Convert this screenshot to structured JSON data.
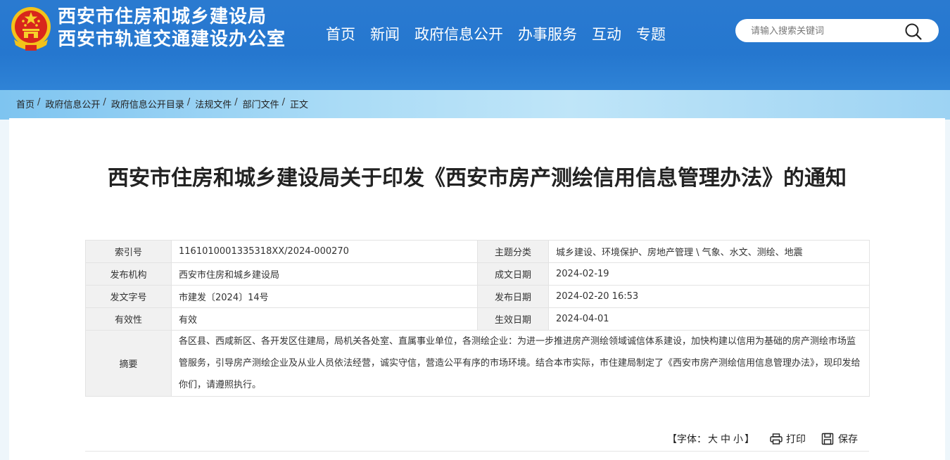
{
  "header": {
    "org_name_1": "西安市住房和城乡建设局",
    "org_name_2": "西安市轨道交通建设办公室",
    "emblem_icon": "national-emblem-icon",
    "bg_color": "#2577cf"
  },
  "nav": {
    "items": [
      "首页",
      "新闻",
      "政府信息公开",
      "办事服务",
      "互动",
      "专题"
    ]
  },
  "search": {
    "placeholder": "请输入搜索关键词",
    "icon": "search-icon"
  },
  "breadcrumb": {
    "items": [
      "首页",
      "政府信息公开",
      "政府信息公开目录",
      "法规文件",
      "部门文件",
      "正文"
    ],
    "separator": "/"
  },
  "document": {
    "title": "西安市住房和城乡建设局关于印发《西安市房产测绘信用信息管理办法》的通知"
  },
  "meta": {
    "index_label": "索引号",
    "index_value": "1161010001335318XX/2024-000270",
    "category_label": "主题分类",
    "category_value": "城乡建设、环境保护、房地产管理 \\ 气象、水文、测绘、地震",
    "issuer_label": "发布机构",
    "issuer_value": "西安市住房和城乡建设局",
    "created_label": "成文日期",
    "created_value": "2024-02-19",
    "docno_label": "发文字号",
    "docno_value": "市建发〔2024〕14号",
    "published_label": "发布日期",
    "published_value": "2024-02-20 16:53",
    "validity_label": "有效性",
    "validity_value": "有效",
    "effective_label": "生效日期",
    "effective_value": "2024-04-01",
    "abstract_label": "摘要",
    "abstract_value": "各区县、西咸新区、各开发区住建局，局机关各处室、直属事业单位，各测绘企业：为进一步推进房产测绘领域诚信体系建设，加快构建以信用为基础的房产测绘市场监管服务，引导房产测绘企业及从业人员依法经营，诚实守信，营造公平有序的市场环境。结合本市实际，市住建局制定了《西安市房产测绘信用信息管理办法》，现印发给你们，请遵照执行。"
  },
  "tools": {
    "font_prefix": "【字体：",
    "font_large": "大",
    "font_medium": "中",
    "font_small": "小",
    "font_suffix": "】",
    "print_label": "打印",
    "print_icon": "printer-icon",
    "save_label": "保存",
    "save_icon": "save-icon"
  }
}
